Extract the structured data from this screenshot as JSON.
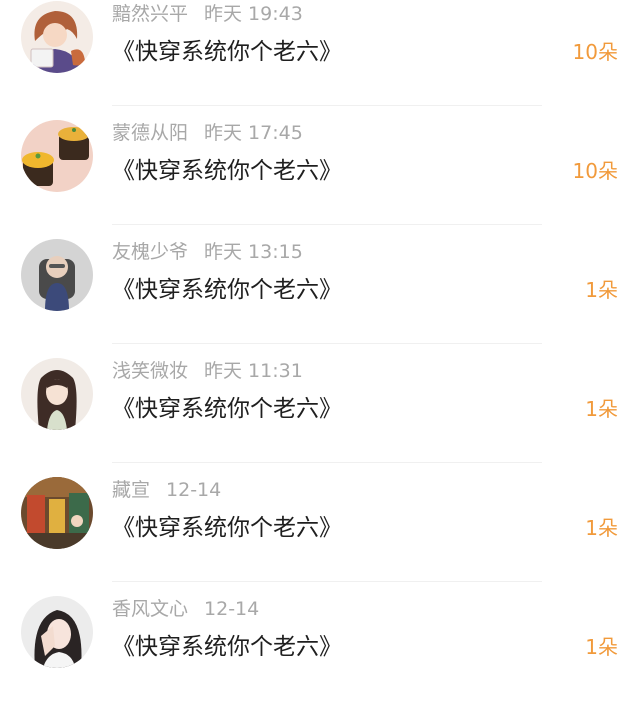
{
  "gifts": [
    {
      "name": "黯然兴平",
      "time": "昨天 19:43",
      "title": "《快穿系统你个老六》",
      "amount": "10朵",
      "avatar": "girl-with-book-avatar"
    },
    {
      "name": "蒙德从阳",
      "time": "昨天 17:45",
      "title": "《快穿系统你个老六》",
      "amount": "10朵",
      "avatar": "cupcakes-avatar"
    },
    {
      "name": "友槐少爷",
      "time": "昨天 13:15",
      "title": "《快穿系统你个老六》",
      "amount": "1朵",
      "avatar": "child-photo-avatar"
    },
    {
      "name": "浅笑微妆",
      "time": "昨天 11:31",
      "title": "《快穿系统你个老六》",
      "amount": "1朵",
      "avatar": "anime-girl-avatar"
    },
    {
      "name": "藏宣",
      "time": "12-14",
      "title": "《快穿系统你个老六》",
      "amount": "1朵",
      "avatar": "street-scene-avatar"
    },
    {
      "name": "香风文心",
      "time": "12-14",
      "title": "《快穿系统你个老六》",
      "amount": "1朵",
      "avatar": "girl-portrait-avatar"
    }
  ],
  "colors": {
    "accent": "#f19a3b",
    "name": "#a8a8a8",
    "title": "#1f1f1f",
    "divider": "#f0f0f0"
  }
}
